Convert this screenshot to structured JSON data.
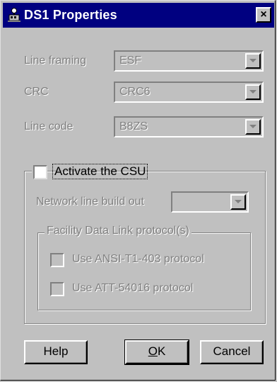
{
  "dialog": {
    "title": "DS1 Properties",
    "close_glyph": "×"
  },
  "fields": {
    "line_framing": {
      "label": "Line framing",
      "value": "ESF"
    },
    "crc": {
      "label": "CRC",
      "value": "CRC6"
    },
    "line_code": {
      "label": "Line code",
      "value": "B8ZS"
    }
  },
  "csu": {
    "label": "Activate the CSU",
    "checked": false,
    "network_lbo_label": "Network line build out",
    "network_lbo_value": "",
    "fdl_group_label": "Facility Data Link protocol(s)",
    "ansi_label": "Use ANSI-T1-403 protocol",
    "att_label": "Use ATT-54016 protocol"
  },
  "buttons": {
    "help": "Help",
    "ok_mnemonic": "O",
    "ok_rest": "K",
    "cancel": "Cancel"
  },
  "colors": {
    "titlebar": "#000080",
    "face": "#c0c0c0",
    "disabled_text": "#808080"
  }
}
